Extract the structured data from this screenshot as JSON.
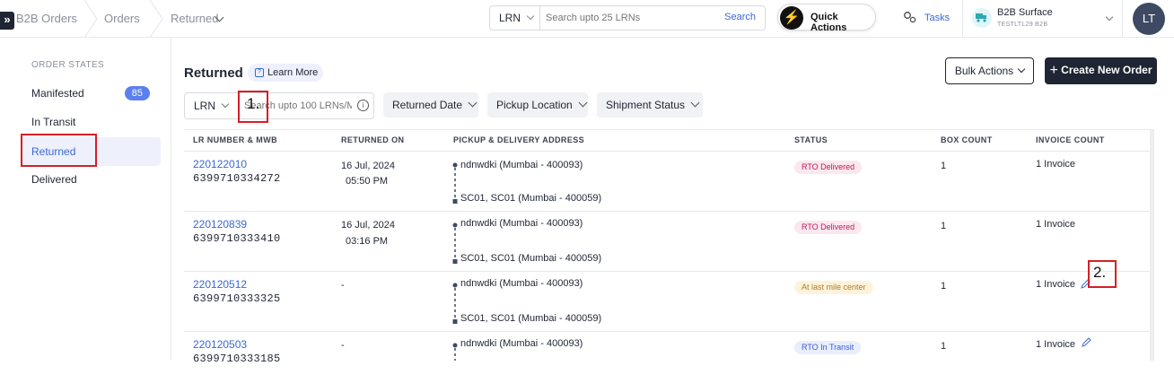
{
  "breadcrumb": {
    "items": [
      "B2B Orders",
      "Orders",
      "Returned"
    ]
  },
  "header": {
    "search": {
      "type": "LRN",
      "placeholder": "Search upto 25 LRNs",
      "button": "Search"
    },
    "quick_actions": "Quick Actions",
    "tasks": "Tasks",
    "workspace": {
      "name": "B2B Surface",
      "code": "TESTLTL29 B2B"
    },
    "avatar": "LT"
  },
  "sidebar": {
    "heading": "ORDER STATES",
    "items": [
      {
        "label": "Manifested",
        "count": "85"
      },
      {
        "label": "In Transit"
      },
      {
        "label": "Returned"
      },
      {
        "label": "Delivered"
      }
    ]
  },
  "page": {
    "title": "Returned",
    "learn_more": "Learn More",
    "bulk_actions": "Bulk Actions",
    "create_order": "Create New Order"
  },
  "filters": {
    "lrn_type": "LRN",
    "search_placeholder": "Search upto 100 LRNs/M",
    "returned_date": "Returned Date",
    "pickup_location": "Pickup Location",
    "shipment_status": "Shipment Status"
  },
  "table": {
    "columns": [
      "LR NUMBER & MWB",
      "RETURNED ON",
      "PICKUP & DELIVERY ADDRESS",
      "STATUS",
      "BOX COUNT",
      "INVOICE COUNT"
    ],
    "rows": [
      {
        "lr": "220122010",
        "mwb": "6399710334272",
        "date": "16 Jul, 2024",
        "time": "05:50 PM",
        "pickup": "ndnwdki (Mumbai - 400093)",
        "delivery": "SC01, SC01 (Mumbai - 400059)",
        "status": "RTO Delivered",
        "boxes": "1",
        "invoices": "1 Invoice"
      },
      {
        "lr": "220120839",
        "mwb": "6399710333410",
        "date": "16 Jul, 2024",
        "time": "03:16 PM",
        "pickup": "ndnwdki (Mumbai - 400093)",
        "delivery": "SC01, SC01 (Mumbai - 400059)",
        "status": "RTO Delivered",
        "boxes": "1",
        "invoices": "1 Invoice"
      },
      {
        "lr": "220120512",
        "mwb": "6399710333325",
        "date": "-",
        "time": "",
        "pickup": "ndnwdki (Mumbai - 400093)",
        "delivery": "SC01, SC01 (Mumbai - 400059)",
        "status": "At last mile center",
        "boxes": "1",
        "invoices": "1 Invoice"
      },
      {
        "lr": "220120503",
        "mwb": "6399710333185",
        "date": "-",
        "time": "",
        "pickup": "ndnwdki (Mumbai - 400093)",
        "delivery": "",
        "status": "RTO In Transit",
        "boxes": "1",
        "invoices": "1 Invoice"
      }
    ]
  },
  "annotations": {
    "one": "1.",
    "two": "2."
  },
  "colors": {
    "accent": "#5b7ff1",
    "link": "#3a67d6",
    "mark": "#d61f26",
    "rto_delivered": "#c2185b",
    "last_mile": "#b7791f",
    "in_transit": "#3a5bd9"
  }
}
